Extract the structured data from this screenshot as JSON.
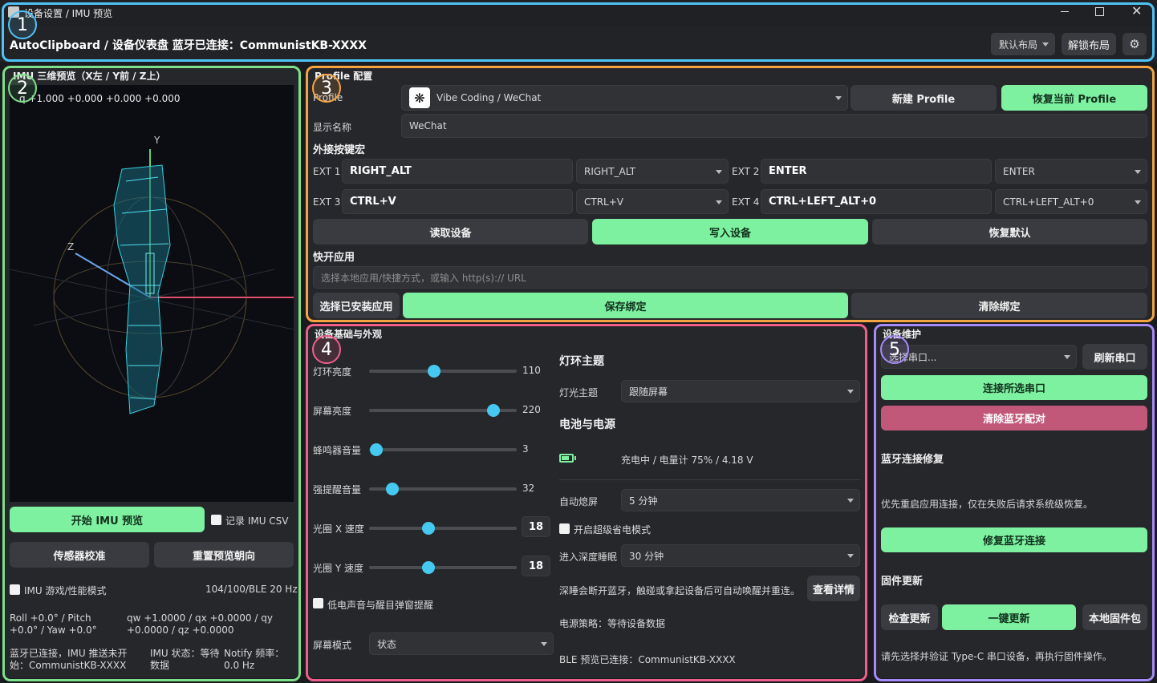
{
  "window": {
    "title": "设备设置 / IMU 预览"
  },
  "header": {
    "title": "AutoClipboard / 设备仪表盘  蓝牙已连接：CommunistKB-XXXX",
    "layout_select": "默认布局",
    "unlock_button": "解锁布局"
  },
  "imu": {
    "title": "IMU 三维预览（X左 / Y前 / Z上）",
    "quat": "q +1.000 +0.000 +0.000 +0.000",
    "axis_y": "Y",
    "axis_z": "Z",
    "start_button": "开始 IMU 预览",
    "record_csv": "记录 IMU CSV",
    "calibrate_button": "传感器校准",
    "reset_button": "重置预览朝向",
    "game_mode": "IMU 游戏/性能模式",
    "rate": "104/100/BLE 20 Hz",
    "euler": "Roll +0.0° / Pitch +0.0° / Yaw +0.0°",
    "quat_detail": "qw +1.0000 / qx +0.0000 / qy +0.0000 / qz +0.0000",
    "status": "蓝牙已连接，IMU 推送未开始：CommunistKB-XXXX",
    "imu_status": "IMU 状态：等待数据",
    "notify": "Notify 频率：0.0 Hz"
  },
  "profile": {
    "title": "Profile 配置",
    "label": "Profile",
    "selected": "Vibe Coding / WeChat",
    "new_button": "新建 Profile",
    "restore_button": "恢复当前 Profile",
    "display_name_label": "显示名称",
    "display_name": "WeChat",
    "macro_title": "外接按键宏",
    "ext1_label": "EXT 1",
    "ext1_value": "RIGHT_ALT",
    "ext1_select": "RIGHT_ALT",
    "ext2_label": "EXT 2",
    "ext2_value": "ENTER",
    "ext2_select": "ENTER",
    "ext3_label": "EXT 3",
    "ext3_value": "CTRL+V",
    "ext3_select": "CTRL+V",
    "ext4_label": "EXT 4",
    "ext4_value": "CTRL+LEFT_ALT+0",
    "ext4_select": "CTRL+LEFT_ALT+0",
    "read_button": "读取设备",
    "write_button": "写入设备",
    "default_button": "恢复默认",
    "quick_title": "快开应用",
    "quick_placeholder": "选择本地应用/快捷方式，或输入 http(s):// URL",
    "choose_button": "选择已安装应用",
    "save_button": "保存绑定",
    "clear_button": "清除绑定"
  },
  "device": {
    "title": "设备基础与外观",
    "sliders": [
      {
        "label": "灯环亮度",
        "value": "110",
        "fraction": 0.44
      },
      {
        "label": "屏幕亮度",
        "value": "220",
        "fraction": 0.84
      },
      {
        "label": "蜂鸣器音量",
        "value": "3",
        "fraction": 0.05
      },
      {
        "label": "强提醒音量",
        "value": "32",
        "fraction": 0.16
      },
      {
        "label": "光圈 X 速度",
        "value": "18",
        "fraction": 0.4
      },
      {
        "label": "光圈 Y 速度",
        "value": "18",
        "fraction": 0.4
      }
    ],
    "low_power_prompt": "低电声音与醒目弹窗提醒",
    "screen_mode_label": "屏幕模式",
    "screen_mode": "状态",
    "ring_theme_title": "灯环主题",
    "light_theme_label": "灯光主题",
    "light_theme": "跟随屏幕",
    "battery_title": "电池与电源",
    "battery_status": "充电中 / 电量计 75% / 4.18 V",
    "battery_level": 0.75,
    "auto_off_label": "自动熄屏",
    "auto_off": "5 分钟",
    "super_save": "开启超级省电模式",
    "deep_sleep_label": "进入深度睡眠",
    "deep_sleep": "30 分钟",
    "deep_sleep_note": "深睡会断开蓝牙，触碰或拿起设备后可自动唤醒并重连。",
    "details_button": "查看详情",
    "power_policy": "电源策略：等待设备数据",
    "ble_status": "BLE 预览已连接：CommunistKB-XXXX"
  },
  "maint": {
    "title": "设备维护",
    "port_select": "选择串口...",
    "refresh_button": "刷新串口",
    "connect_button": "连接所选串口",
    "clear_bt_button": "清除蓝牙配对",
    "bt_repair_title": "蓝牙连接修复",
    "bt_repair_note": "优先重启应用连接，仅在失败后请求系统级恢复。",
    "repair_button": "修复蓝牙连接",
    "fw_title": "固件更新",
    "check_button": "检查更新",
    "oneclick_button": "一键更新",
    "local_button": "本地固件包",
    "fw_note": "请先选择并验证 Type-C 串口设备，再执行固件操作。"
  },
  "badges": [
    "1",
    "2",
    "3",
    "4",
    "5"
  ],
  "colors": {
    "accent": "#7ef1a0",
    "danger": "#c1587a",
    "slider": "#46c9f0",
    "hl1": "#4fc3f7",
    "hl2": "#7ee08c",
    "hl3": "#f5a441",
    "hl4": "#ef5f8a",
    "hl5": "#a78bfa"
  }
}
